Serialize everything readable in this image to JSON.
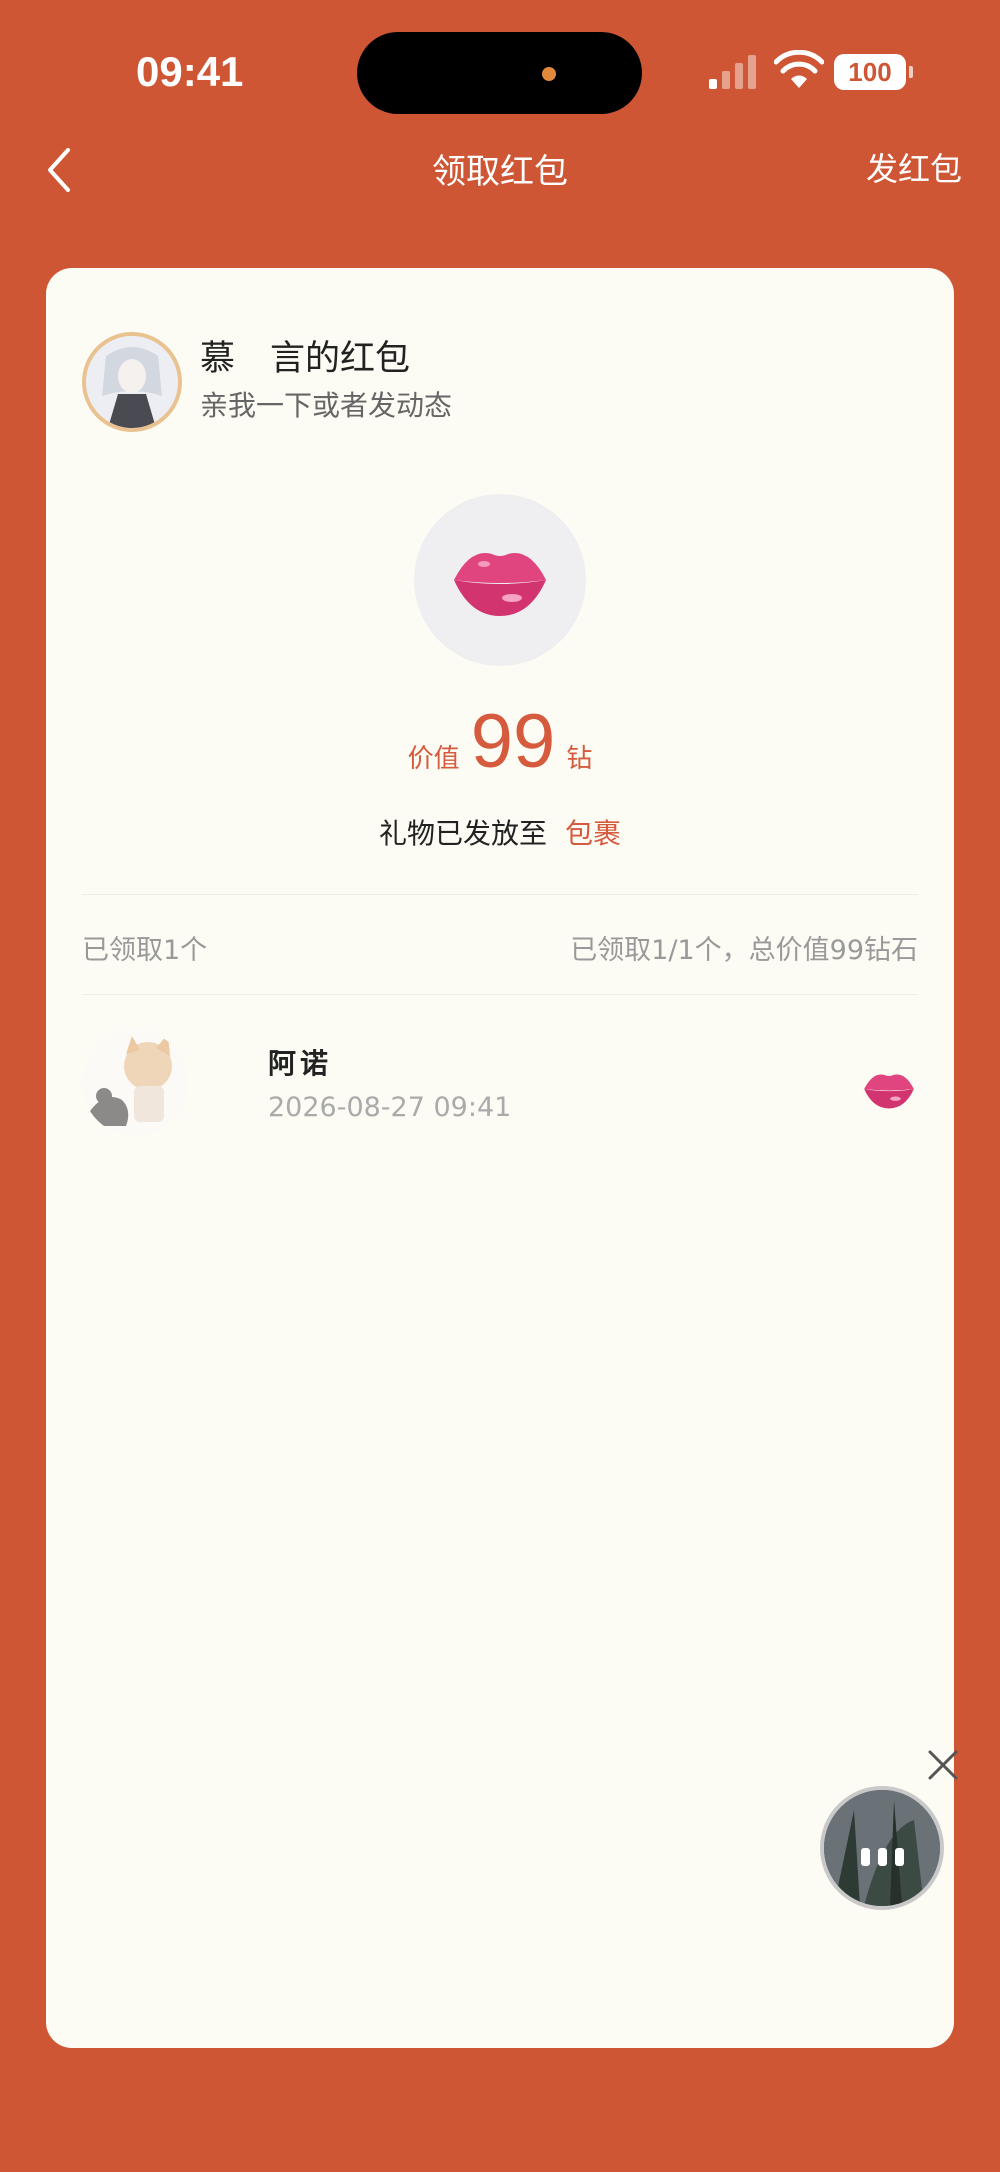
{
  "status_bar": {
    "time": "09:41",
    "battery": "100"
  },
  "nav": {
    "title": "领取红包",
    "action": "发红包"
  },
  "sender": {
    "name": "慕　言的红包",
    "message": "亲我一下或者发动态"
  },
  "gift": {
    "value_label": "价值",
    "value_amount": "99",
    "value_unit": "钻",
    "note": "礼物已发放至",
    "link": "包裹"
  },
  "summary": {
    "received_count": "已领取1个",
    "detail": "已领取1/1个，总价值99钻石"
  },
  "records": [
    {
      "name": "阿诺",
      "time": "2026-08-27 09:41"
    }
  ],
  "colors": {
    "background": "#cf5634",
    "card": "#fdfcf4",
    "accent": "#d65a3d"
  }
}
